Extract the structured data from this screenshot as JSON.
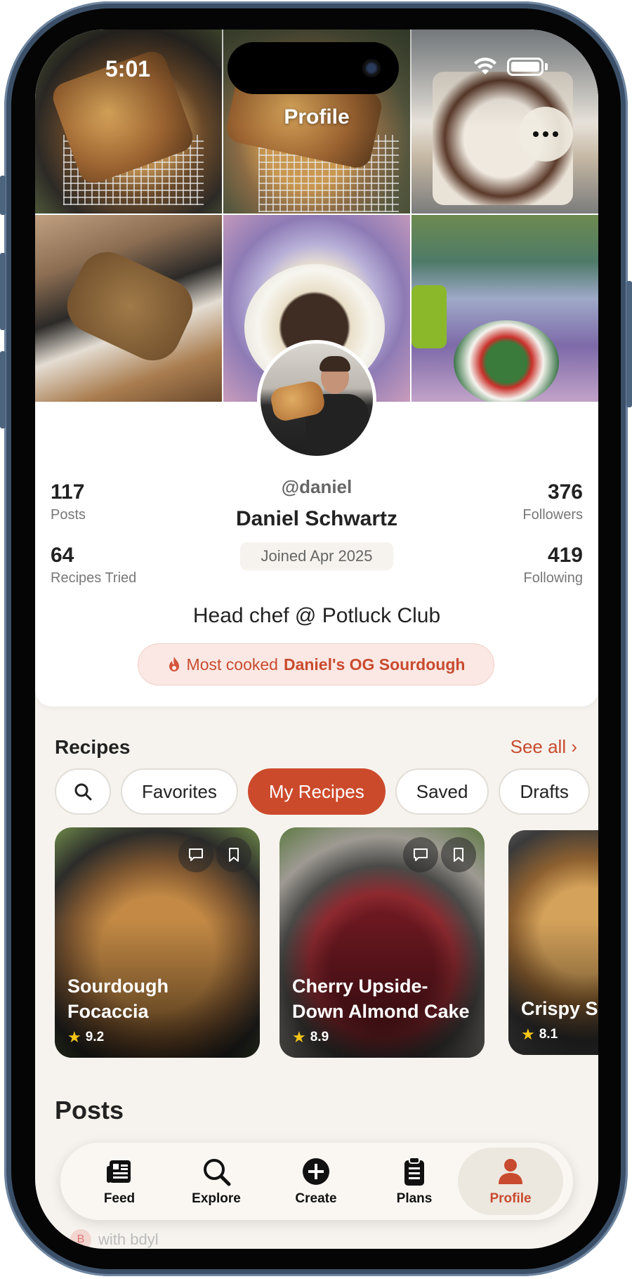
{
  "status": {
    "time": "5:01"
  },
  "nav": {
    "title": "Profile"
  },
  "profile": {
    "handle": "@daniel",
    "name": "Daniel Schwartz",
    "joined": "Joined Apr 2025",
    "bio": "Head chef @ Potluck Club",
    "most_cooked_label": "Most cooked",
    "most_cooked_value": "Daniel's OG Sourdough",
    "stats": {
      "posts": {
        "value": "117",
        "label": "Posts"
      },
      "recipes_tried": {
        "value": "64",
        "label": "Recipes Tried"
      },
      "followers": {
        "value": "376",
        "label": "Followers"
      },
      "following": {
        "value": "419",
        "label": "Following"
      }
    }
  },
  "recipes": {
    "title": "Recipes",
    "see_all": "See all ›",
    "chips": [
      "Favorites",
      "My Recipes",
      "Saved",
      "Drafts"
    ],
    "active_chip": "My Recipes",
    "cards": [
      {
        "title": "Sourdough Focaccia",
        "rating": "9.2"
      },
      {
        "title": "Cherry Upside-Down Almond Cake",
        "rating": "8.9"
      },
      {
        "title": "Crispy S Chicken with Pota",
        "rating": "8.1"
      }
    ]
  },
  "posts": {
    "title": "Posts"
  },
  "tabbar": {
    "items": [
      "Feed",
      "Explore",
      "Create",
      "Plans",
      "Profile"
    ],
    "active": "Profile"
  },
  "peek": {
    "badge": "B",
    "text": "with bdyl"
  },
  "colors": {
    "accent": "#cc4a2c",
    "background": "#f6f3ee",
    "chip_border": "#e2ded7"
  }
}
